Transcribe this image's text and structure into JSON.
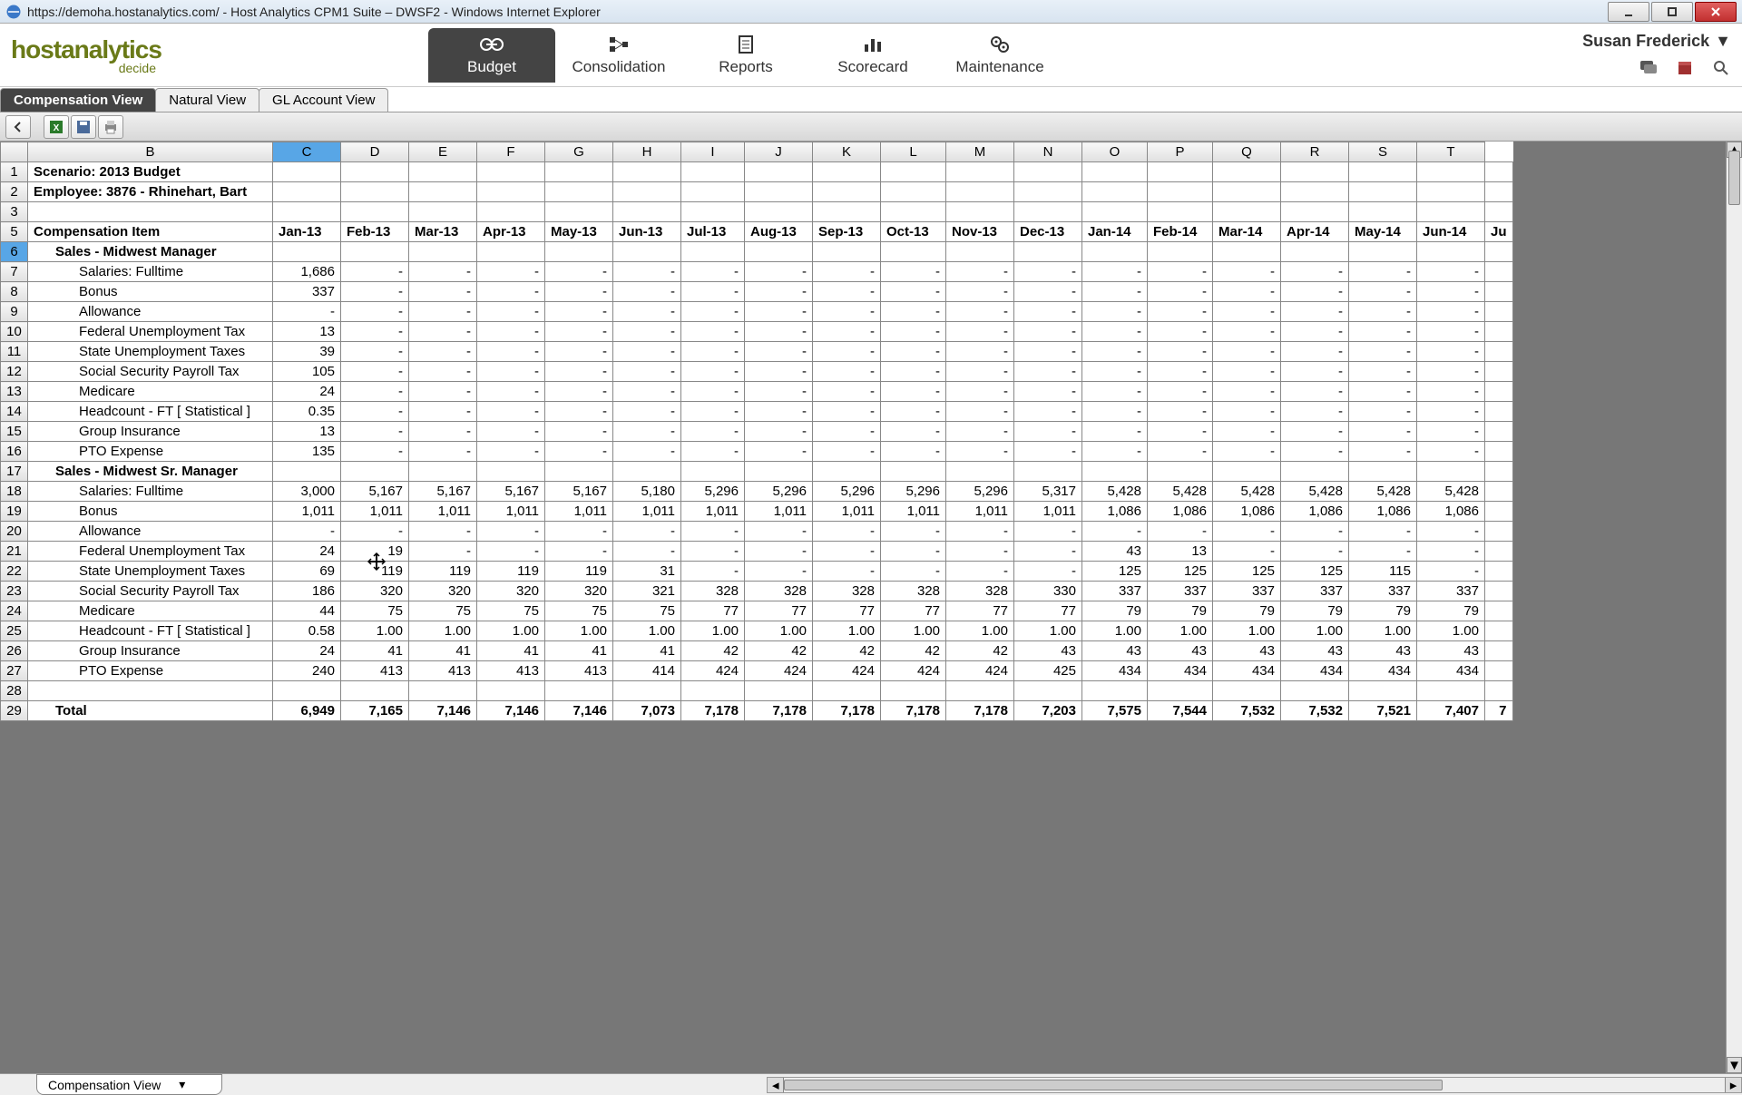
{
  "window": {
    "url_title": "https://demoha.hostanalytics.com/ - Host Analytics CPM1 Suite – DWSF2 - Windows Internet Explorer"
  },
  "logo": {
    "main": "hostanalytics",
    "sub": "decide"
  },
  "nav": [
    {
      "label": "Budget",
      "active": true
    },
    {
      "label": "Consolidation"
    },
    {
      "label": "Reports"
    },
    {
      "label": "Scorecard"
    },
    {
      "label": "Maintenance"
    }
  ],
  "user": {
    "name": "Susan Frederick"
  },
  "tabs": [
    {
      "label": "Compensation View",
      "active": true
    },
    {
      "label": "Natural View"
    },
    {
      "label": "GL Account View"
    }
  ],
  "sheet_tab": {
    "label": "Compensation View"
  },
  "columns": [
    "",
    "B",
    "C",
    "D",
    "E",
    "F",
    "G",
    "H",
    "I",
    "J",
    "K",
    "L",
    "M",
    "N",
    "O",
    "P",
    "Q",
    "R",
    "S",
    "T"
  ],
  "selected_column": "C",
  "selected_row": 6,
  "header_rows": {
    "scenario": "Scenario: 2013 Budget",
    "employee": "Employee: 3876 - Rhinehart, Bart",
    "comp_item": "Compensation Item"
  },
  "months": [
    "Jan-13",
    "Feb-13",
    "Mar-13",
    "Apr-13",
    "May-13",
    "Jun-13",
    "Jul-13",
    "Aug-13",
    "Sep-13",
    "Oct-13",
    "Nov-13",
    "Dec-13",
    "Jan-14",
    "Feb-14",
    "Mar-14",
    "Apr-14",
    "May-14",
    "Jun-14",
    "Ju"
  ],
  "groups": [
    {
      "title": "Sales - Midwest Manager",
      "rows": [
        {
          "label": "Salaries: Fulltime",
          "vals": [
            "1,686",
            "-",
            "-",
            "-",
            "-",
            "-",
            "-",
            "-",
            "-",
            "-",
            "-",
            "-",
            "-",
            "-",
            "-",
            "-",
            "-",
            "-",
            ""
          ]
        },
        {
          "label": "Bonus",
          "vals": [
            "337",
            "-",
            "-",
            "-",
            "-",
            "-",
            "-",
            "-",
            "-",
            "-",
            "-",
            "-",
            "-",
            "-",
            "-",
            "-",
            "-",
            "-",
            ""
          ]
        },
        {
          "label": "Allowance",
          "vals": [
            "-",
            "-",
            "-",
            "-",
            "-",
            "-",
            "-",
            "-",
            "-",
            "-",
            "-",
            "-",
            "-",
            "-",
            "-",
            "-",
            "-",
            "-",
            ""
          ]
        },
        {
          "label": "Federal Unemployment Tax",
          "vals": [
            "13",
            "-",
            "-",
            "-",
            "-",
            "-",
            "-",
            "-",
            "-",
            "-",
            "-",
            "-",
            "-",
            "-",
            "-",
            "-",
            "-",
            "-",
            ""
          ]
        },
        {
          "label": "State Unemployment Taxes",
          "vals": [
            "39",
            "-",
            "-",
            "-",
            "-",
            "-",
            "-",
            "-",
            "-",
            "-",
            "-",
            "-",
            "-",
            "-",
            "-",
            "-",
            "-",
            "-",
            ""
          ]
        },
        {
          "label": "Social Security Payroll Tax",
          "vals": [
            "105",
            "-",
            "-",
            "-",
            "-",
            "-",
            "-",
            "-",
            "-",
            "-",
            "-",
            "-",
            "-",
            "-",
            "-",
            "-",
            "-",
            "-",
            ""
          ]
        },
        {
          "label": "Medicare",
          "vals": [
            "24",
            "-",
            "-",
            "-",
            "-",
            "-",
            "-",
            "-",
            "-",
            "-",
            "-",
            "-",
            "-",
            "-",
            "-",
            "-",
            "-",
            "-",
            ""
          ]
        },
        {
          "label": "Headcount - FT  [ Statistical ]",
          "vals": [
            "0.35",
            "-",
            "-",
            "-",
            "-",
            "-",
            "-",
            "-",
            "-",
            "-",
            "-",
            "-",
            "-",
            "-",
            "-",
            "-",
            "-",
            "-",
            ""
          ]
        },
        {
          "label": "Group Insurance",
          "vals": [
            "13",
            "-",
            "-",
            "-",
            "-",
            "-",
            "-",
            "-",
            "-",
            "-",
            "-",
            "-",
            "-",
            "-",
            "-",
            "-",
            "-",
            "-",
            ""
          ]
        },
        {
          "label": "PTO Expense",
          "vals": [
            "135",
            "-",
            "-",
            "-",
            "-",
            "-",
            "-",
            "-",
            "-",
            "-",
            "-",
            "-",
            "-",
            "-",
            "-",
            "-",
            "-",
            "-",
            ""
          ]
        }
      ]
    },
    {
      "title": "Sales - Midwest Sr. Manager",
      "rows": [
        {
          "label": "Salaries: Fulltime",
          "vals": [
            "3,000",
            "5,167",
            "5,167",
            "5,167",
            "5,167",
            "5,180",
            "5,296",
            "5,296",
            "5,296",
            "5,296",
            "5,296",
            "5,317",
            "5,428",
            "5,428",
            "5,428",
            "5,428",
            "5,428",
            "5,428",
            ""
          ]
        },
        {
          "label": "Bonus",
          "vals": [
            "1,011",
            "1,011",
            "1,011",
            "1,011",
            "1,011",
            "1,011",
            "1,011",
            "1,011",
            "1,011",
            "1,011",
            "1,011",
            "1,011",
            "1,086",
            "1,086",
            "1,086",
            "1,086",
            "1,086",
            "1,086",
            ""
          ]
        },
        {
          "label": "Allowance",
          "vals": [
            "-",
            "-",
            "-",
            "-",
            "-",
            "-",
            "-",
            "-",
            "-",
            "-",
            "-",
            "-",
            "-",
            "-",
            "-",
            "-",
            "-",
            "-",
            ""
          ]
        },
        {
          "label": "Federal Unemployment Tax",
          "vals": [
            "24",
            "19",
            "-",
            "-",
            "-",
            "-",
            "-",
            "-",
            "-",
            "-",
            "-",
            "-",
            "43",
            "13",
            "-",
            "-",
            "-",
            "-",
            ""
          ]
        },
        {
          "label": "State Unemployment Taxes",
          "vals": [
            "69",
            "119",
            "119",
            "119",
            "119",
            "31",
            "-",
            "-",
            "-",
            "-",
            "-",
            "-",
            "125",
            "125",
            "125",
            "125",
            "115",
            "-",
            ""
          ]
        },
        {
          "label": "Social Security Payroll Tax",
          "vals": [
            "186",
            "320",
            "320",
            "320",
            "320",
            "321",
            "328",
            "328",
            "328",
            "328",
            "328",
            "330",
            "337",
            "337",
            "337",
            "337",
            "337",
            "337",
            ""
          ]
        },
        {
          "label": "Medicare",
          "vals": [
            "44",
            "75",
            "75",
            "75",
            "75",
            "75",
            "77",
            "77",
            "77",
            "77",
            "77",
            "77",
            "79",
            "79",
            "79",
            "79",
            "79",
            "79",
            ""
          ]
        },
        {
          "label": "Headcount - FT  [ Statistical ]",
          "vals": [
            "0.58",
            "1.00",
            "1.00",
            "1.00",
            "1.00",
            "1.00",
            "1.00",
            "1.00",
            "1.00",
            "1.00",
            "1.00",
            "1.00",
            "1.00",
            "1.00",
            "1.00",
            "1.00",
            "1.00",
            "1.00",
            ""
          ]
        },
        {
          "label": "Group Insurance",
          "vals": [
            "24",
            "41",
            "41",
            "41",
            "41",
            "41",
            "42",
            "42",
            "42",
            "42",
            "42",
            "43",
            "43",
            "43",
            "43",
            "43",
            "43",
            "43",
            ""
          ]
        },
        {
          "label": "PTO Expense",
          "vals": [
            "240",
            "413",
            "413",
            "413",
            "413",
            "414",
            "424",
            "424",
            "424",
            "424",
            "424",
            "425",
            "434",
            "434",
            "434",
            "434",
            "434",
            "434",
            ""
          ]
        }
      ]
    }
  ],
  "total": {
    "label": "Total",
    "vals": [
      "6,949",
      "7,165",
      "7,146",
      "7,146",
      "7,146",
      "7,073",
      "7,178",
      "7,178",
      "7,178",
      "7,178",
      "7,178",
      "7,203",
      "7,575",
      "7,544",
      "7,532",
      "7,532",
      "7,521",
      "7,407",
      "7"
    ]
  },
  "cursor_cell": {
    "row": "22",
    "col": "D",
    "display_value": "119"
  }
}
